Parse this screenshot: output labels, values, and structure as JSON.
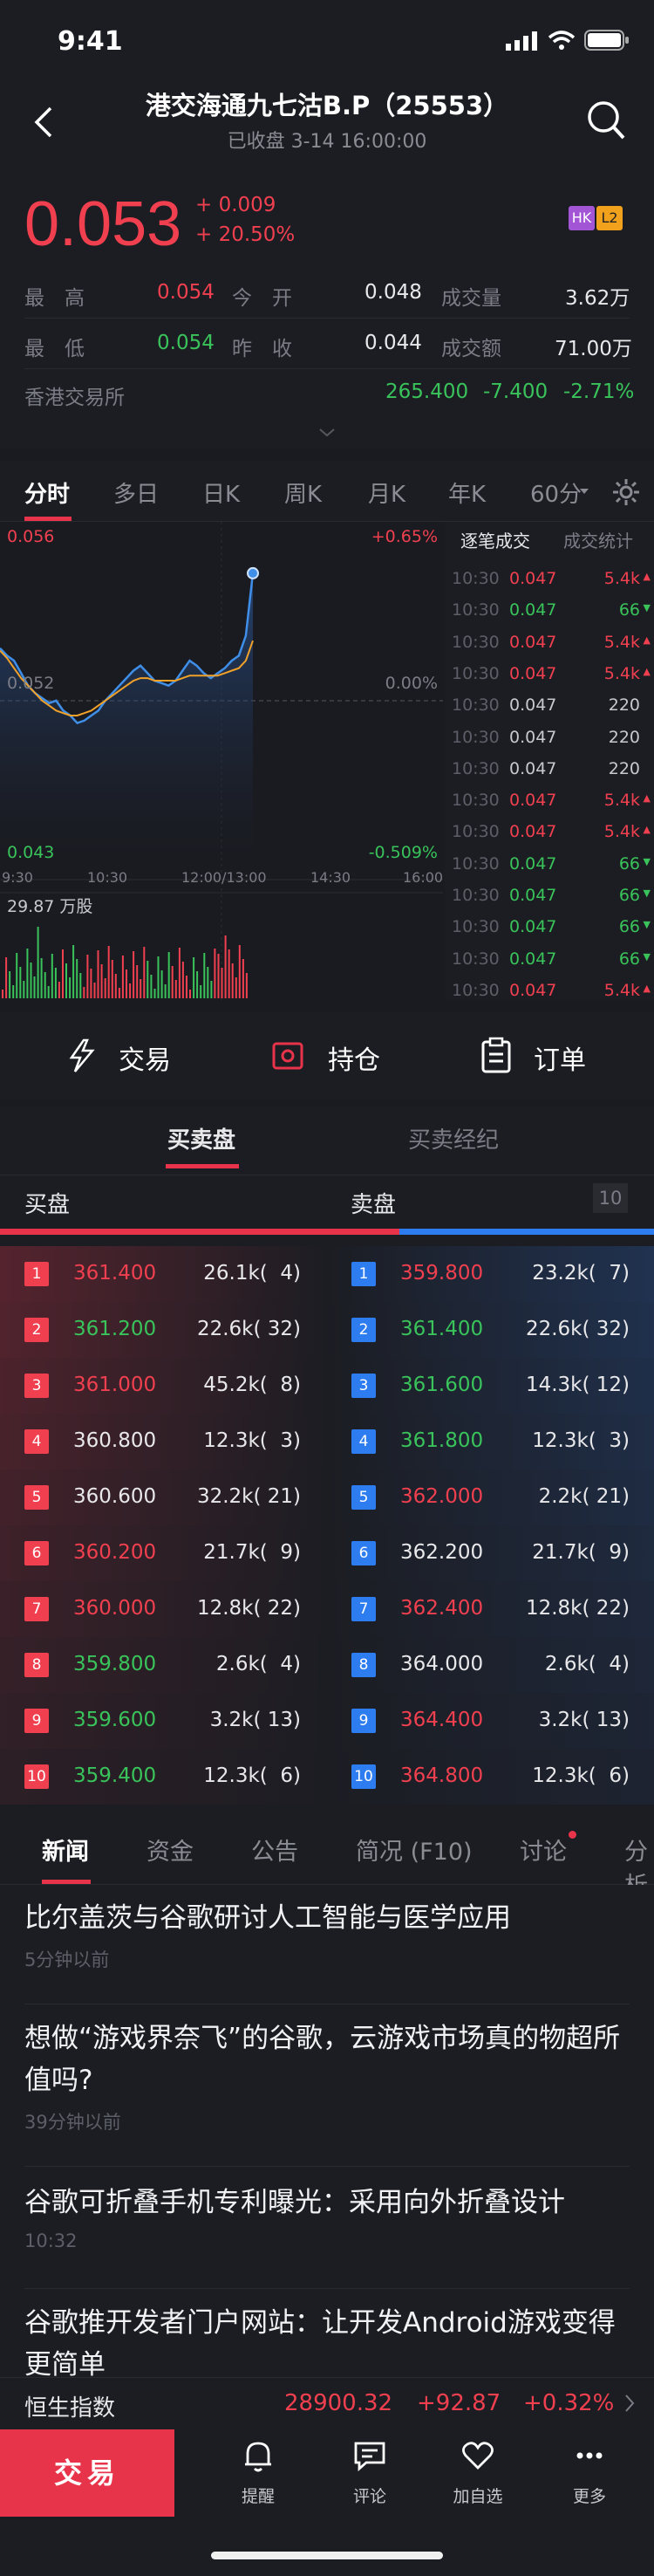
{
  "status": {
    "time": "9:41"
  },
  "header": {
    "title": "港交海通九七沽B.P（25553）",
    "subtitle": "已收盘 3-14 16:00:00"
  },
  "quote": {
    "price": "0.053",
    "change": "+ 0.009",
    "change_pct": "+ 20.50%",
    "badge_hk": "HK",
    "badge_l2": "L2",
    "rows": [
      {
        "l1": "最　高",
        "v1": "0.054",
        "l2": "今　开",
        "v2": "0.048",
        "l3": "成交量",
        "v3": "3.62万"
      },
      {
        "l1": "最　低",
        "v1": "0.054",
        "l2": "昨　收",
        "v2": "0.044",
        "l3": "成交额",
        "v3": "71.00万"
      }
    ],
    "exchange": {
      "name": "香港交易所",
      "value": "265.400",
      "change": "-7.400",
      "pct": "-2.71%"
    }
  },
  "ktabs": [
    "分时",
    "多日",
    "日K",
    "周K",
    "月K",
    "年K",
    "60分"
  ],
  "chart_data": {
    "type": "line",
    "title": "",
    "y_max_label": "0.056",
    "y_mid_label": "0.052",
    "y_min_label": "0.043",
    "pct_top": "+0.65%",
    "pct_mid": "0.00%",
    "pct_bottom": "-0.509%",
    "x_ticks": [
      "9:30",
      "10:30",
      "12:00/13:00",
      "14:30",
      "16:00"
    ],
    "volume_label": "29.87 万股",
    "ylim": [
      0.043,
      0.056
    ],
    "price": [
      0.0515,
      0.0512,
      0.051,
      0.0505,
      0.05,
      0.0497,
      0.0495,
      0.0493,
      0.0494,
      0.049,
      0.0488,
      0.0485,
      0.0486,
      0.0488,
      0.049,
      0.0494,
      0.0497,
      0.05,
      0.0503,
      0.0506,
      0.0508,
      0.0505,
      0.0502,
      0.0501,
      0.05,
      0.0502,
      0.0506,
      0.051,
      0.0508,
      0.0505,
      0.0503,
      0.0505,
      0.0507,
      0.051,
      0.0512,
      0.052,
      0.0545
    ],
    "avg": [
      0.0514,
      0.0511,
      0.0507,
      0.0503,
      0.05,
      0.0497,
      0.0494,
      0.0492,
      0.049,
      0.0489,
      0.0488,
      0.0488,
      0.0489,
      0.049,
      0.0492,
      0.0494,
      0.0496,
      0.0498,
      0.05,
      0.0502,
      0.0503,
      0.0503,
      0.0502,
      0.0502,
      0.0502,
      0.0502,
      0.0503,
      0.0504,
      0.0504,
      0.0504,
      0.0504,
      0.0504,
      0.0505,
      0.0506,
      0.0507,
      0.051,
      0.0518
    ]
  },
  "trades": {
    "tab_active": "逐笔成交",
    "tab_other": "成交统计",
    "rows": [
      {
        "t": "10:30",
        "p": "0.047",
        "v": "5.4k",
        "d": "up"
      },
      {
        "t": "10:30",
        "p": "0.047",
        "v": "66",
        "d": "down"
      },
      {
        "t": "10:30",
        "p": "0.047",
        "v": "5.4k",
        "d": "up"
      },
      {
        "t": "10:30",
        "p": "0.047",
        "v": "5.4k",
        "d": "up"
      },
      {
        "t": "10:30",
        "p": "0.047",
        "v": "220",
        "d": "none"
      },
      {
        "t": "10:30",
        "p": "0.047",
        "v": "220",
        "d": "none"
      },
      {
        "t": "10:30",
        "p": "0.047",
        "v": "220",
        "d": "none"
      },
      {
        "t": "10:30",
        "p": "0.047",
        "v": "5.4k",
        "d": "up"
      },
      {
        "t": "10:30",
        "p": "0.047",
        "v": "5.4k",
        "d": "up"
      },
      {
        "t": "10:30",
        "p": "0.047",
        "v": "66",
        "d": "down"
      },
      {
        "t": "10:30",
        "p": "0.047",
        "v": "66",
        "d": "down"
      },
      {
        "t": "10:30",
        "p": "0.047",
        "v": "66",
        "d": "down"
      },
      {
        "t": "10:30",
        "p": "0.047",
        "v": "66",
        "d": "down"
      },
      {
        "t": "10:30",
        "p": "0.047",
        "v": "5.4k",
        "d": "up"
      }
    ]
  },
  "actions": {
    "trade": "交易",
    "position": "持仓",
    "orders": "订单"
  },
  "orderbook": {
    "tab_active": "买卖盘",
    "tab_other": "买卖经纪",
    "bid_label": "买盘",
    "ask_label": "卖盘",
    "depth": "10",
    "bids": [
      {
        "n": "1",
        "p": "361.400",
        "v": "26.1k(  4)",
        "c": "red"
      },
      {
        "n": "2",
        "p": "361.200",
        "v": "22.6k( 32)",
        "c": "green"
      },
      {
        "n": "3",
        "p": "361.000",
        "v": "45.2k(  8)",
        "c": "red"
      },
      {
        "n": "4",
        "p": "360.800",
        "v": "12.3k(  3)",
        "c": "white"
      },
      {
        "n": "5",
        "p": "360.600",
        "v": "32.2k( 21)",
        "c": "white"
      },
      {
        "n": "6",
        "p": "360.200",
        "v": "21.7k(  9)",
        "c": "red"
      },
      {
        "n": "7",
        "p": "360.000",
        "v": "12.8k( 22)",
        "c": "red"
      },
      {
        "n": "8",
        "p": "359.800",
        "v": "2.6k(  4)",
        "c": "green"
      },
      {
        "n": "9",
        "p": "359.600",
        "v": "3.2k( 13)",
        "c": "green"
      },
      {
        "n": "10",
        "p": "359.400",
        "v": "12.3k(  6)",
        "c": "green"
      }
    ],
    "asks": [
      {
        "n": "1",
        "p": "359.800",
        "v": "23.2k(  7)",
        "c": "red"
      },
      {
        "n": "2",
        "p": "361.400",
        "v": "22.6k( 32)",
        "c": "green"
      },
      {
        "n": "3",
        "p": "361.600",
        "v": "14.3k( 12)",
        "c": "green"
      },
      {
        "n": "4",
        "p": "361.800",
        "v": "12.3k(  3)",
        "c": "green"
      },
      {
        "n": "5",
        "p": "362.000",
        "v": "2.2k( 21)",
        "c": "red"
      },
      {
        "n": "6",
        "p": "362.200",
        "v": "21.7k(  9)",
        "c": "white"
      },
      {
        "n": "7",
        "p": "362.400",
        "v": "12.8k( 22)",
        "c": "red"
      },
      {
        "n": "8",
        "p": "364.000",
        "v": "2.6k(  4)",
        "c": "white"
      },
      {
        "n": "9",
        "p": "364.400",
        "v": "3.2k( 13)",
        "c": "red"
      },
      {
        "n": "10",
        "p": "364.800",
        "v": "12.3k(  6)",
        "c": "red"
      }
    ]
  },
  "news_tabs": [
    "新闻",
    "资金",
    "公告",
    "简况 (F10)",
    "讨论",
    "分析"
  ],
  "news": [
    {
      "title": "比尔盖茨与谷歌研讨人工智能与医学应用",
      "time": "5分钟以前"
    },
    {
      "title": "想做“游戏界奈飞”的谷歌，云游戏市场真的物超所值吗?",
      "time": "39分钟以前"
    },
    {
      "title": "谷歌可折叠手机专利曝光：采用向外折叠设计",
      "time": "10:32"
    },
    {
      "title": "谷歌推开发者门户网站：让开发Android游戏变得更简单",
      "time": ""
    }
  ],
  "index_bar": {
    "name": "恒生指数",
    "value": "28900.32",
    "change": "+92.87",
    "pct": "+0.32%"
  },
  "bottom_nav": {
    "trade": "交易",
    "alert": "提醒",
    "comment": "评论",
    "watch": "加自选",
    "more": "更多"
  },
  "colors": {
    "up": "#f0404f",
    "down": "#39c35a",
    "accent": "#e8344a",
    "ask_blue": "#2d7cf0"
  }
}
